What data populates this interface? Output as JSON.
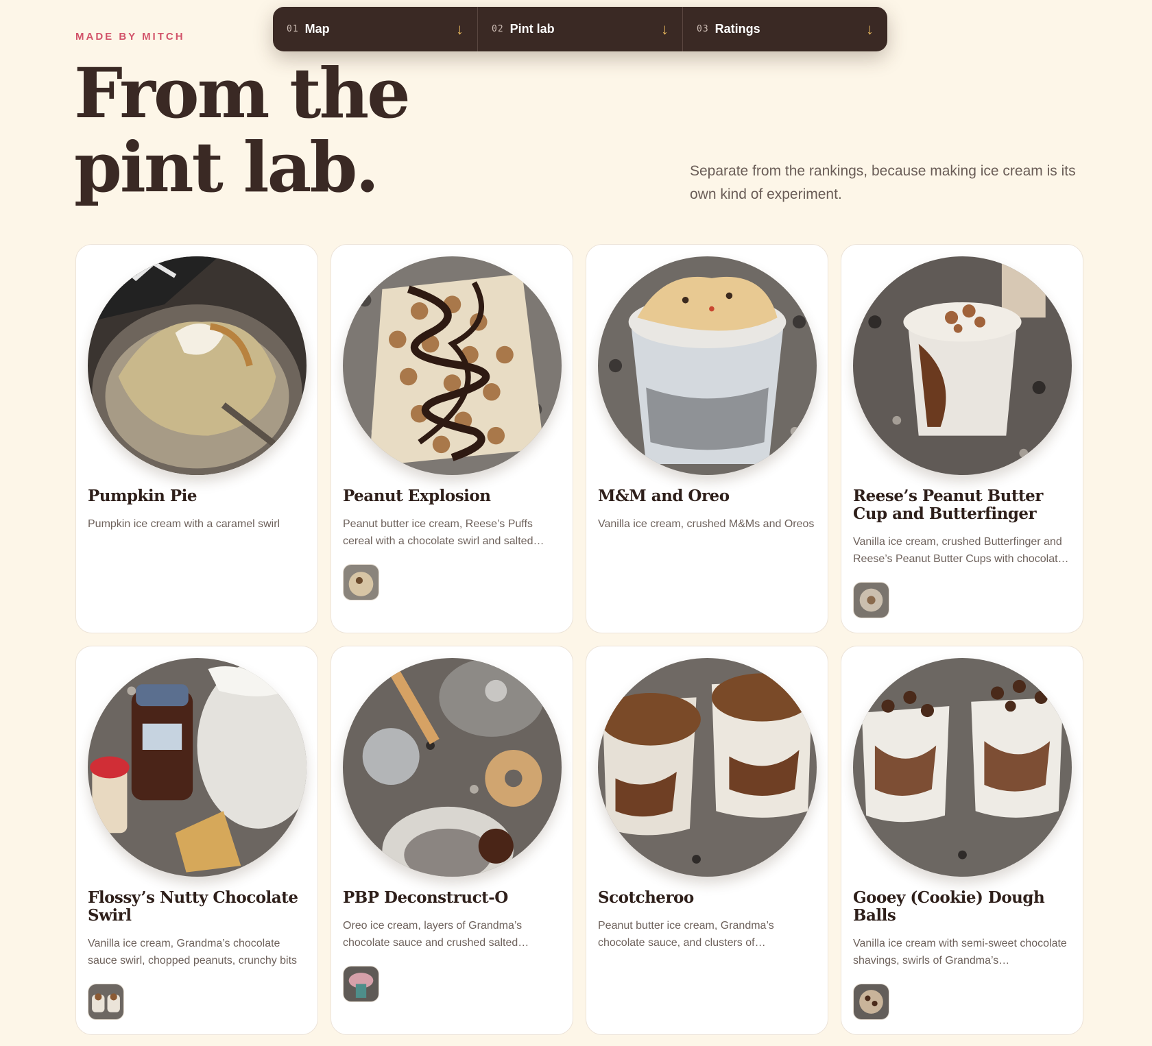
{
  "nav": {
    "items": [
      {
        "num": "01",
        "label": "Map",
        "arrow": "↓"
      },
      {
        "num": "02",
        "label": "Pint lab",
        "arrow": "↓"
      },
      {
        "num": "03",
        "label": "Ratings",
        "arrow": "↓"
      }
    ],
    "arrow_color": "#e3b35a"
  },
  "header": {
    "kicker": "MADE BY MITCH",
    "title": "From the pint lab.",
    "subtitle": "Separate from the rankings, because making ice cream is its own kind of experiment."
  },
  "colors": {
    "background": "#fdf6e8",
    "nav_bg": "#3a2924",
    "kicker": "#d2536a",
    "title": "#3a2924",
    "card_bg": "#ffffff"
  },
  "recipes": [
    {
      "name": "Pumpkin Pie",
      "description": "Pumpkin ice cream with a caramel swirl",
      "photo": "pumpkin-pie-photo",
      "has_thumb": false
    },
    {
      "name": "Peanut Explosion",
      "description": "Peanut butter ice cream, Reese’s Puffs cereal with a chocolate swirl and salted…",
      "photo": "peanut-explosion-photo",
      "has_thumb": true
    },
    {
      "name": "M&M and Oreo",
      "description": "Vanilla ice cream, crushed M&Ms and Oreos",
      "photo": "mm-oreo-photo",
      "has_thumb": false
    },
    {
      "name": "Reese’s Peanut Butter Cup and Butterfinger",
      "description": "Vanilla ice cream, crushed Butterfinger and Reese’s Peanut Butter Cups with chocolat…",
      "photo": "reeses-butterfinger-photo",
      "has_thumb": true
    },
    {
      "name": "Flossy’s Nutty Chocolate Swirl",
      "description": "Vanilla ice cream, Grandma’s chocolate sauce swirl, chopped peanuts, crunchy bits",
      "photo": "nutty-chocolate-photo",
      "has_thumb": true
    },
    {
      "name": "PBP Deconstruct-O",
      "description": "Oreo ice cream, layers of Grandma’s chocolate sauce and crushed salted…",
      "photo": "pbp-deconstructo-photo",
      "has_thumb": true
    },
    {
      "name": "Scotcheroo",
      "description": "Peanut butter ice cream, Grandma’s chocolate sauce, and clusters of…",
      "photo": "scotcheroo-photo",
      "has_thumb": false
    },
    {
      "name": "Gooey (Cookie) Dough Balls",
      "description": "Vanilla ice cream with semi-sweet chocolate shavings, swirls of Grandma’s…",
      "photo": "cookie-dough-photo",
      "has_thumb": true
    }
  ]
}
